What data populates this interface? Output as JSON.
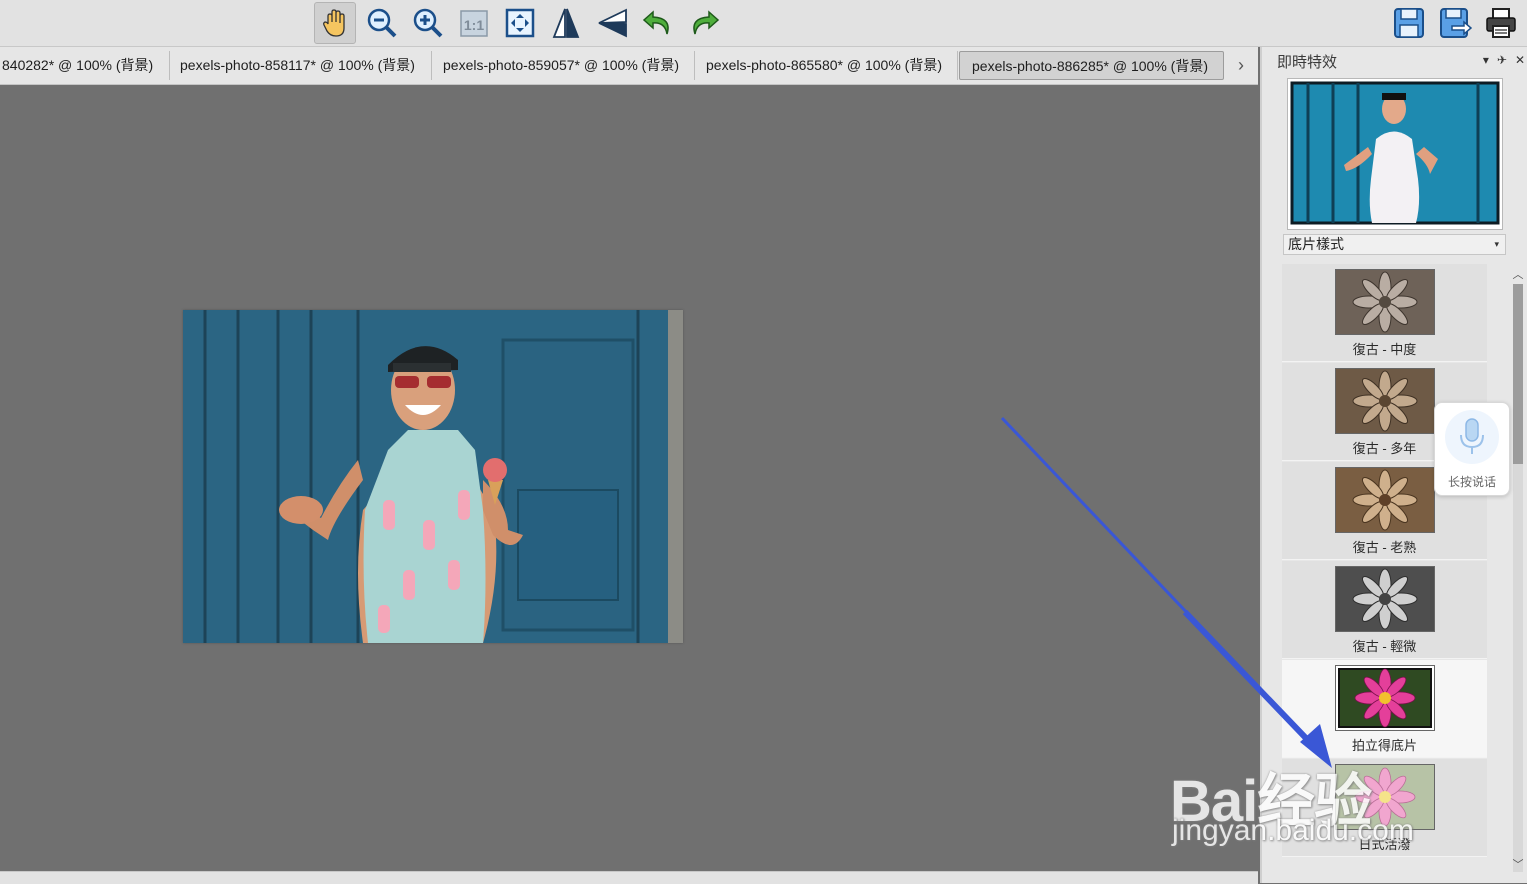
{
  "toolbar": {
    "left_tools": [
      {
        "name": "hand-tool",
        "icon": "hand-icon",
        "active": true
      },
      {
        "name": "zoom-out",
        "icon": "zoom-out-icon"
      },
      {
        "name": "zoom-in",
        "icon": "zoom-in-icon"
      },
      {
        "name": "actual-size",
        "icon": "actual-size-icon",
        "label": "1:1"
      },
      {
        "name": "fit-window",
        "icon": "fit-window-icon"
      },
      {
        "name": "flip-horizontal",
        "icon": "flip-horizontal-icon"
      },
      {
        "name": "flip-vertical",
        "icon": "flip-vertical-icon"
      },
      {
        "name": "undo",
        "icon": "undo-icon"
      },
      {
        "name": "redo",
        "icon": "redo-icon"
      }
    ],
    "right_tools": [
      {
        "name": "save",
        "icon": "save-icon"
      },
      {
        "name": "save-as",
        "icon": "save-as-icon"
      },
      {
        "name": "print",
        "icon": "print-icon"
      }
    ]
  },
  "tabs": [
    {
      "label": "840282* @ 100% (背景)"
    },
    {
      "label": "pexels-photo-858117* @ 100% (背景)"
    },
    {
      "label": "pexels-photo-859057* @ 100% (背景)"
    },
    {
      "label": "pexels-photo-865580* @ 100% (背景)"
    },
    {
      "label": "pexels-photo-886285* @ 100% (背景)",
      "active": true
    }
  ],
  "panel": {
    "title": "即時特效",
    "category": "底片樣式",
    "effects": [
      {
        "label": "復古 - 中度",
        "style": "sepia-medium"
      },
      {
        "label": "復古 - 多年",
        "style": "sepia-old"
      },
      {
        "label": "復古 - 老熟",
        "style": "sepia-aged"
      },
      {
        "label": "復古 - 輕微",
        "style": "sepia-light"
      },
      {
        "label": "拍立得底片",
        "style": "polaroid",
        "selected": true
      },
      {
        "label": "日式活潑",
        "style": "japanese-lively"
      }
    ]
  },
  "voice_widget": {
    "label": "长按说话",
    "icon": "microphone-icon"
  },
  "watermark": {
    "brand": "Bai经验",
    "url": "jingyan.baidu.com"
  },
  "colors": {
    "canvas_bg": "#707070",
    "arrow": "#3a57d6",
    "door_blue": "#2f6c8a"
  }
}
